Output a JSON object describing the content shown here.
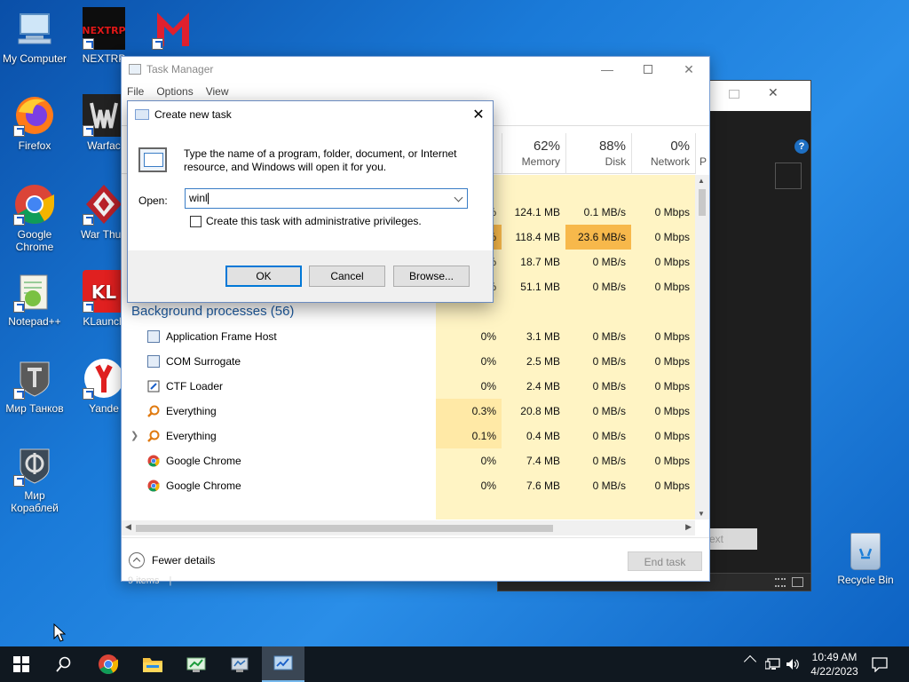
{
  "desktop": {
    "icons": [
      {
        "label": "My Computer"
      },
      {
        "label": "NEXTRP"
      },
      {
        "label": "Firefox"
      },
      {
        "label": "Warfac"
      },
      {
        "label": "Google Chrome"
      },
      {
        "label": "War Thun"
      },
      {
        "label": "Notepad++"
      },
      {
        "label": "KLaunch"
      },
      {
        "label": "Мир Танков"
      },
      {
        "label": "Yande"
      },
      {
        "label": "Мир Кораблей"
      }
    ],
    "recycle_bin": "Recycle Bin",
    "nextrp_logo": "NEXTRP"
  },
  "task_manager": {
    "title": "Task Manager",
    "menu": [
      "File",
      "Options",
      "View"
    ],
    "columns": {
      "memory": {
        "pct": "62%",
        "label": "Memory"
      },
      "disk": {
        "pct": "88%",
        "label": "Disk"
      },
      "network": {
        "pct": "0%",
        "label": "Network"
      },
      "power": {
        "label": "P"
      }
    },
    "app_rows": [
      {
        "cpu_fragment": "",
        "memory": "",
        "disk": "",
        "network": ""
      },
      {
        "cpu_fragment": "%",
        "memory": "124.1 MB",
        "disk": "0.1 MB/s",
        "network": "0 Mbps"
      },
      {
        "cpu_fragment": "%",
        "memory": "118.4 MB",
        "disk": "23.6 MB/s",
        "network": "0 Mbps"
      },
      {
        "cpu_fragment": "%",
        "memory": "18.7 MB",
        "disk": "0 MB/s",
        "network": "0 Mbps"
      },
      {
        "cpu_fragment": "%",
        "memory": "51.1 MB",
        "disk": "0 MB/s",
        "network": "0 Mbps"
      }
    ],
    "background_section": "Background processes (56)",
    "processes": [
      {
        "name": "Application Frame Host",
        "icon": "app-frame-icon",
        "cpu": "0%",
        "memory": "3.1 MB",
        "disk": "0 MB/s",
        "network": "0 Mbps"
      },
      {
        "name": "COM Surrogate",
        "icon": "com-surrogate-icon",
        "cpu": "0%",
        "memory": "2.5 MB",
        "disk": "0 MB/s",
        "network": "0 Mbps"
      },
      {
        "name": "CTF Loader",
        "icon": "ctf-loader-icon",
        "cpu": "0%",
        "memory": "2.4 MB",
        "disk": "0 MB/s",
        "network": "0 Mbps"
      },
      {
        "name": "Everything",
        "icon": "everything-search-icon",
        "cpu": "0.3%",
        "memory": "20.8 MB",
        "disk": "0 MB/s",
        "network": "0 Mbps"
      },
      {
        "name": "Everything",
        "icon": "everything-search-icon",
        "cpu": "0.1%",
        "memory": "0.4 MB",
        "disk": "0 MB/s",
        "network": "0 Mbps"
      },
      {
        "name": "Google Chrome",
        "icon": "chrome-icon",
        "cpu": "0%",
        "memory": "7.4 MB",
        "disk": "0 MB/s",
        "network": "0 Mbps"
      },
      {
        "name": "Google Chrome",
        "icon": "chrome-icon",
        "cpu": "0%",
        "memory": "7.6 MB",
        "disk": "0 MB/s",
        "network": "0 Mbps"
      }
    ],
    "fewer_details": "Fewer details",
    "end_task": "End task",
    "status_items": "9 items",
    "status_sep": "|"
  },
  "bg_window": {
    "button_fragment": "ext"
  },
  "dialog": {
    "title": "Create new task",
    "description": "Type the name of a program, folder, document, or Internet resource, and Windows will open it for you.",
    "open_label": "Open:",
    "open_value": "winl",
    "admin_label": "Create this task with administrative privileges.",
    "ok": "OK",
    "cancel": "Cancel",
    "browse": "Browse..."
  },
  "taskbar": {
    "time": "10:49 AM",
    "date": "4/22/2023"
  },
  "colors": {
    "disk_highlight": "#f7b84b",
    "usage_yellow": "#fff4c4",
    "accent": "#0078d7"
  }
}
